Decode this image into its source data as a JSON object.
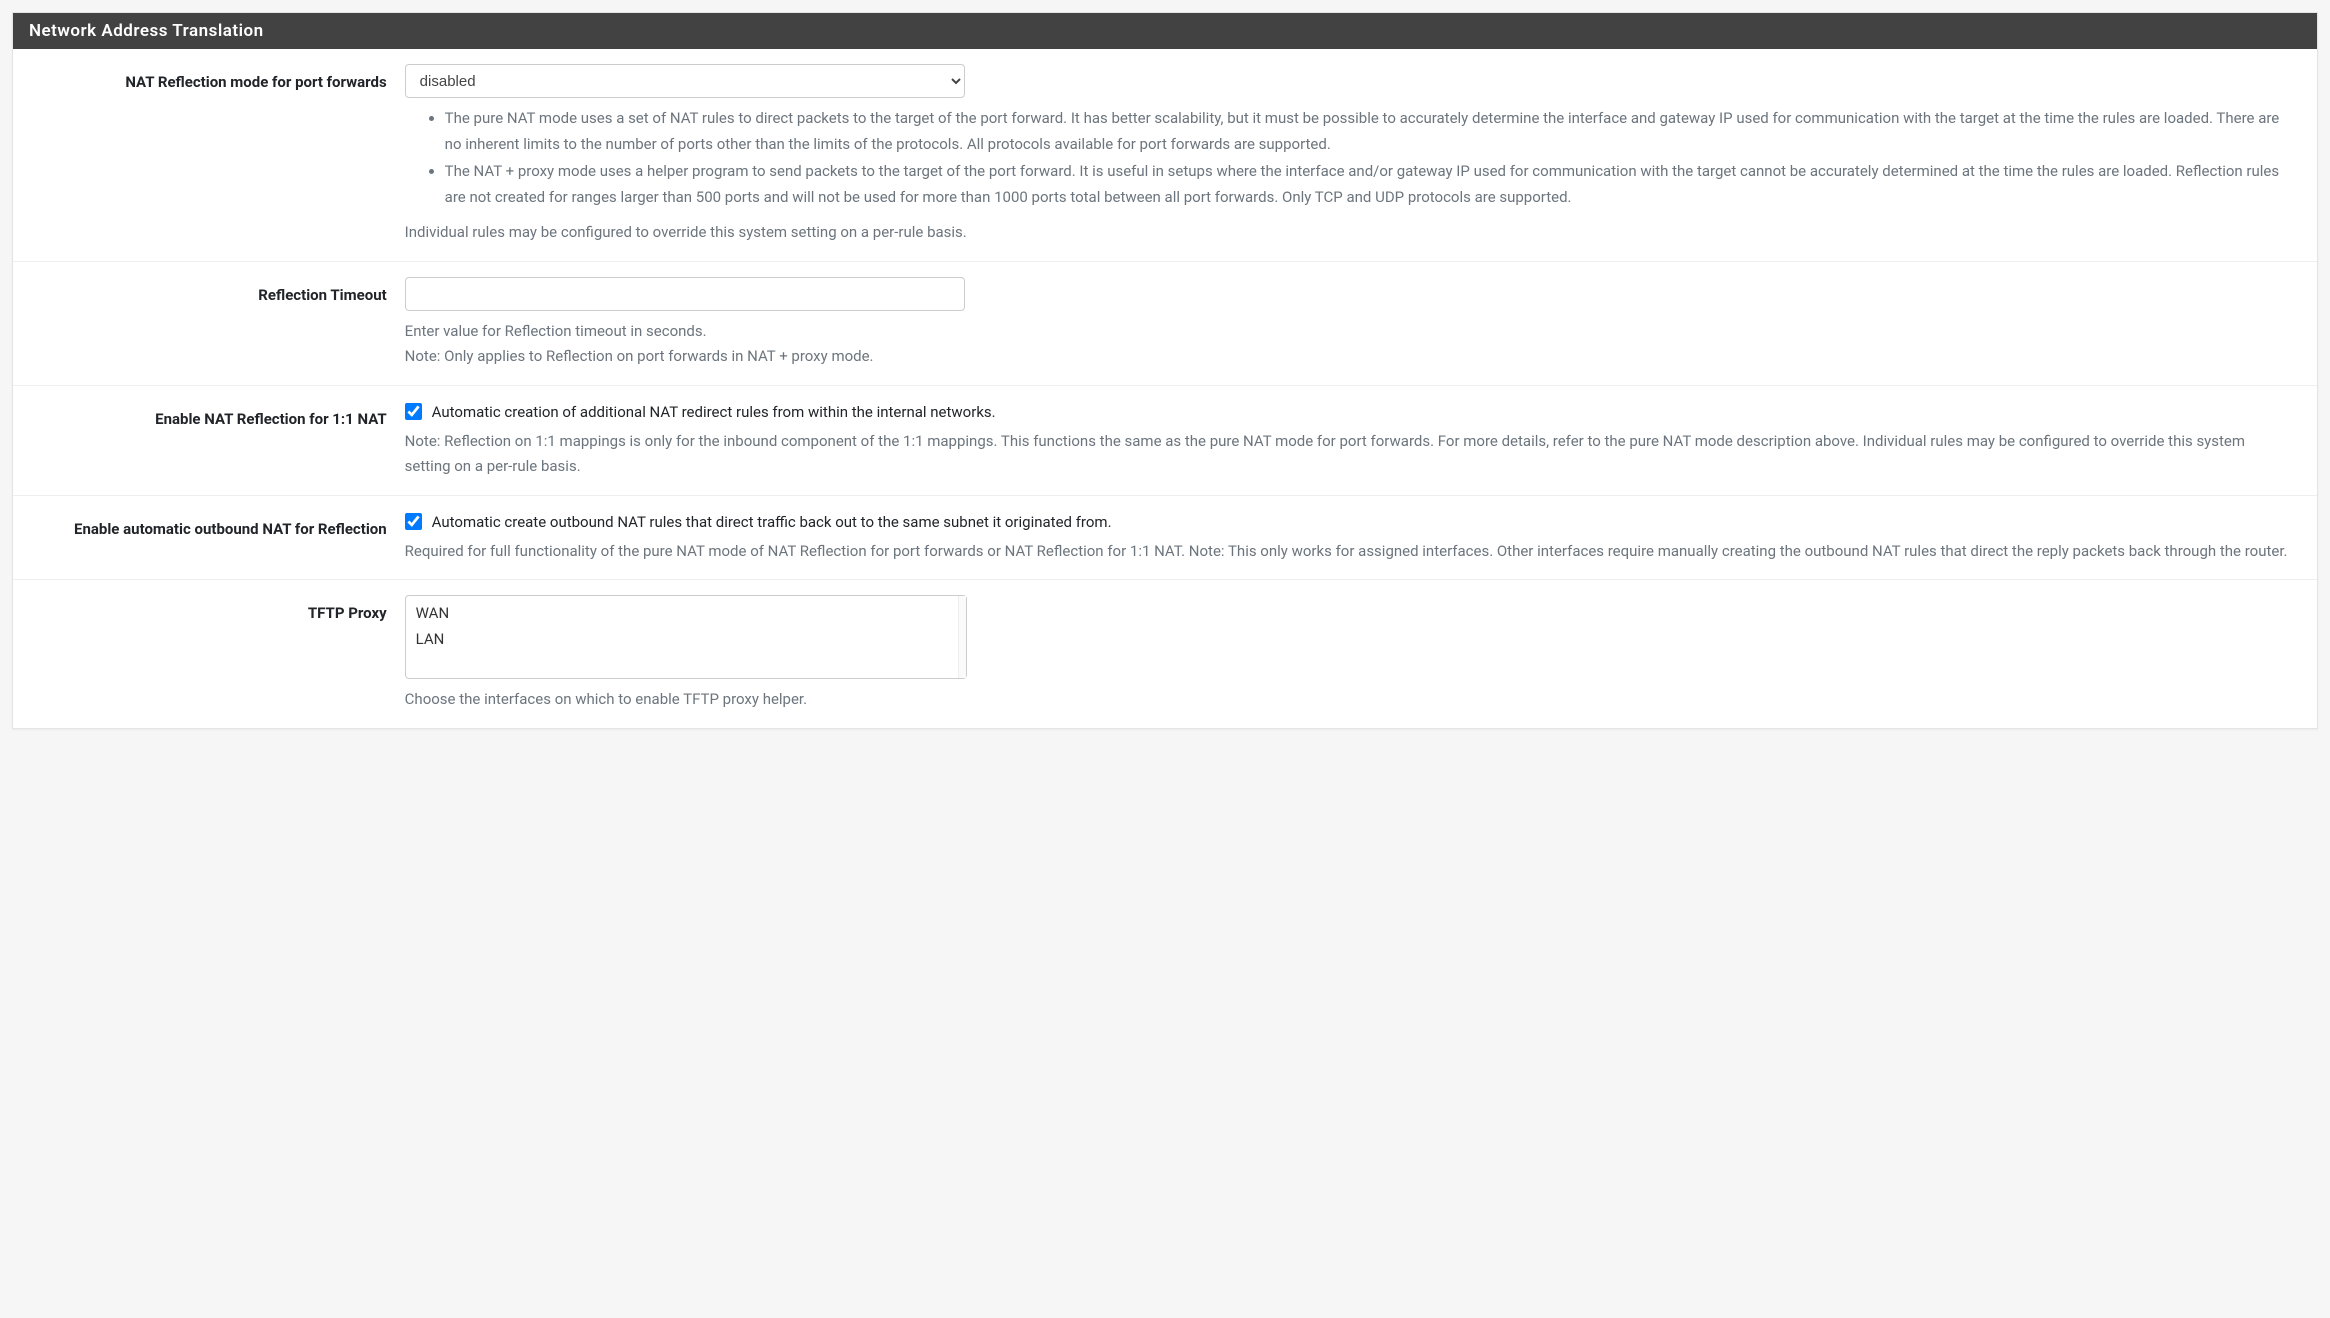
{
  "panel": {
    "title": "Network Address Translation"
  },
  "fields": {
    "nat_reflection_mode": {
      "label": "NAT Reflection mode for port forwards",
      "selected": "disabled",
      "help_bullet_1": "The pure NAT mode uses a set of NAT rules to direct packets to the target of the port forward. It has better scalability, but it must be possible to accurately determine the interface and gateway IP used for communication with the target at the time the rules are loaded. There are no inherent limits to the number of ports other than the limits of the protocols. All protocols available for port forwards are supported.",
      "help_bullet_2": "The NAT + proxy mode uses a helper program to send packets to the target of the port forward. It is useful in setups where the interface and/or gateway IP used for communication with the target cannot be accurately determined at the time the rules are loaded. Reflection rules are not created for ranges larger than 500 ports and will not be used for more than 1000 ports total between all port forwards. Only TCP and UDP protocols are supported.",
      "help_footer": "Individual rules may be configured to override this system setting on a per-rule basis."
    },
    "reflection_timeout": {
      "label": "Reflection Timeout",
      "value": "",
      "help_line_1": "Enter value for Reflection timeout in seconds.",
      "help_line_2": "Note: Only applies to Reflection on port forwards in NAT + proxy mode."
    },
    "enable_nat_reflection_1to1": {
      "label": "Enable NAT Reflection for 1:1 NAT",
      "checked": true,
      "checkbox_label": "Automatic creation of additional NAT redirect rules from within the internal networks.",
      "help": "Note: Reflection on 1:1 mappings is only for the inbound component of the 1:1 mappings. This functions the same as the pure NAT mode for port forwards. For more details, refer to the pure NAT mode description above. Individual rules may be configured to override this system setting on a per-rule basis."
    },
    "enable_auto_outbound": {
      "label": "Enable automatic outbound NAT for Reflection",
      "checked": true,
      "checkbox_label": "Automatic create outbound NAT rules that direct traffic back out to the same subnet it originated from.",
      "help": "Required for full functionality of the pure NAT mode of NAT Reflection for port forwards or NAT Reflection for 1:1 NAT. Note: This only works for assigned interfaces. Other interfaces require manually creating the outbound NAT rules that direct the reply packets back through the router."
    },
    "tftp_proxy": {
      "label": "TFTP Proxy",
      "options": [
        "WAN",
        "LAN"
      ],
      "help": "Choose the interfaces on which to enable TFTP proxy helper."
    }
  }
}
